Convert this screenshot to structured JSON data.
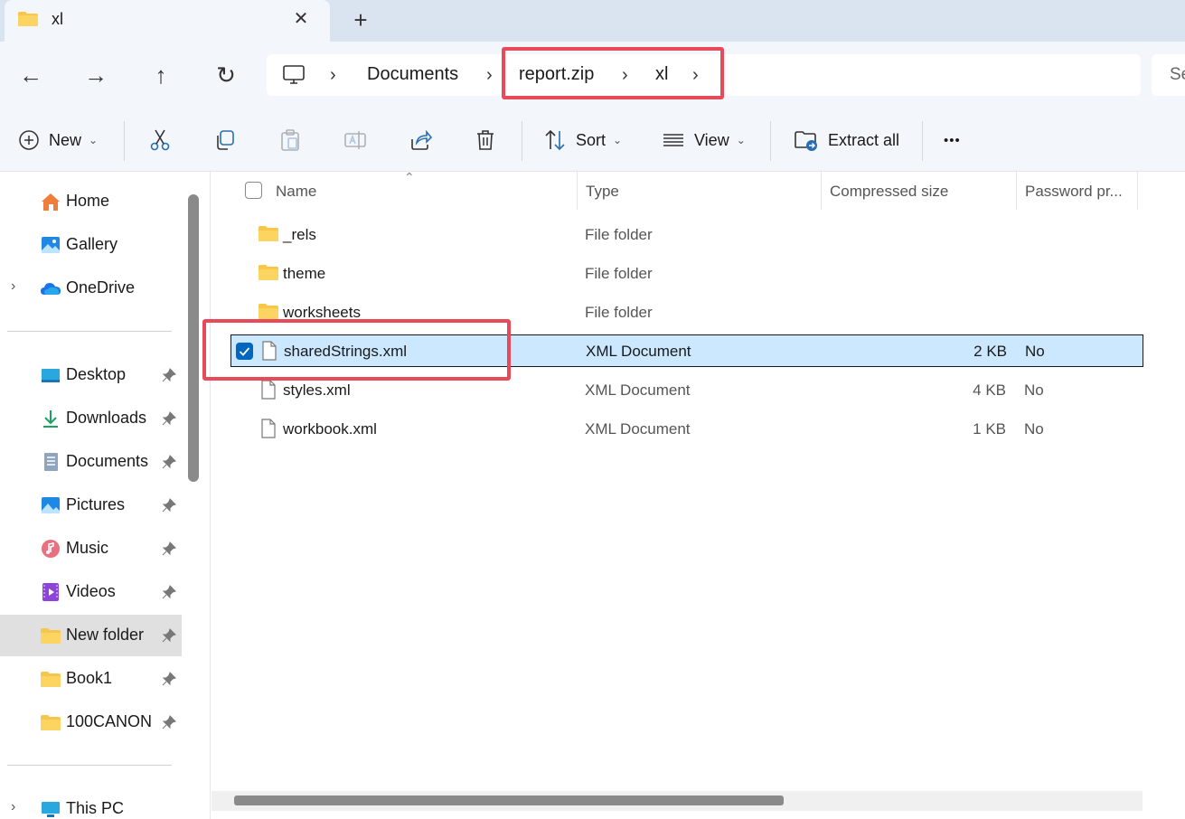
{
  "tab": {
    "title": "xl",
    "close": "✕",
    "new": "+"
  },
  "nav": {
    "back": "←",
    "forward": "→",
    "up": "↑",
    "refresh": "↻"
  },
  "breadcrumb": [
    {
      "label": "Documents"
    },
    {
      "label": "report.zip"
    },
    {
      "label": "xl"
    }
  ],
  "breadcrumb_sep": "›",
  "search": {
    "placeholder": "Se"
  },
  "toolbar": {
    "new_label": "New",
    "sort_label": "Sort",
    "view_label": "View",
    "extract_label": "Extract all",
    "more_label": "•••",
    "chevron": "⌄"
  },
  "sidebar": {
    "top": [
      {
        "label": "Home",
        "icon": "home-icon"
      },
      {
        "label": "Gallery",
        "icon": "gallery-icon"
      },
      {
        "label": "OneDrive",
        "icon": "onedrive-icon",
        "expand": "›"
      }
    ],
    "pinned": [
      {
        "label": "Desktop",
        "icon": "desktop-icon"
      },
      {
        "label": "Downloads",
        "icon": "downloads-icon"
      },
      {
        "label": "Documents",
        "icon": "documents-icon"
      },
      {
        "label": "Pictures",
        "icon": "pictures-icon"
      },
      {
        "label": "Music",
        "icon": "music-icon"
      },
      {
        "label": "Videos",
        "icon": "videos-icon"
      },
      {
        "label": "New folder",
        "icon": "folder-icon",
        "selected": true
      },
      {
        "label": "Book1",
        "icon": "folder-icon"
      },
      {
        "label": "100CANON",
        "icon": "folder-icon"
      }
    ],
    "bottom": [
      {
        "label": "This PC",
        "icon": "this-pc-icon",
        "expand": "›"
      }
    ]
  },
  "columns": {
    "name": "Name",
    "type": "Type",
    "compressed": "Compressed size",
    "password": "Password pr..."
  },
  "files": [
    {
      "name": "_rels",
      "type": "File folder",
      "size": "",
      "password": "",
      "kind": "folder"
    },
    {
      "name": "theme",
      "type": "File folder",
      "size": "",
      "password": "",
      "kind": "folder"
    },
    {
      "name": "worksheets",
      "type": "File folder",
      "size": "",
      "password": "",
      "kind": "folder"
    },
    {
      "name": "sharedStrings.xml",
      "type": "XML Document",
      "size": "2 KB",
      "password": "No",
      "kind": "file",
      "selected": true
    },
    {
      "name": "styles.xml",
      "type": "XML Document",
      "size": "4 KB",
      "password": "No",
      "kind": "file"
    },
    {
      "name": "workbook.xml",
      "type": "XML Document",
      "size": "1 KB",
      "password": "No",
      "kind": "file"
    }
  ],
  "colors": {
    "accent": "#0067c0",
    "highlight": "#e84a5a",
    "selection": "#cce8ff",
    "folder": "#f8c648"
  }
}
